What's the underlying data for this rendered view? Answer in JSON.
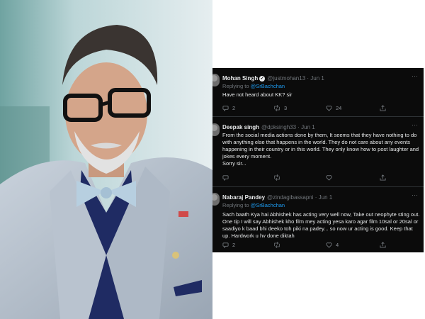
{
  "tweets": [
    {
      "name": "Mohan Singh",
      "handle": "@justmohan13 · Jun 1",
      "replying_prefix": "Replying to ",
      "replying_to": "@SrBachchan",
      "text": "Have not heard about KK? sir",
      "reply_count": "2",
      "retweet_count": "3",
      "like_count": "24"
    },
    {
      "name": "Deepak singh",
      "handle": "@dpksingh33 · Jun 1",
      "text": "From the social media actions done by them, It seems that they have nothing to do with anything else that happens in the world. They do not care about any events happening in their country or in this world.  They only know how to post laughter and jokes every moment.",
      "text2": "Sorry sir...",
      "reply_count": "",
      "retweet_count": "",
      "like_count": ""
    },
    {
      "name": "Nabaraj Pandey",
      "handle": "@zindagibassapni · Jun 1",
      "replying_prefix": "Replying to ",
      "replying_to": "@SrBachchan",
      "text": "Sach baath Kya hai Abhishek has acting very well now, Take out neophyte sting out. One tip I will say Abhishek kho film mey acting yesa karo agar film 10sal or 20sal or saadiyo k baad bhi deeko toh piki na padey... so now ur acting is good. Keep that up. Hardwork u hv done diktah",
      "reply_count": "2",
      "retweet_count": "",
      "like_count": "4"
    }
  ],
  "icons": {
    "more": "more-icon",
    "reply": "reply-icon",
    "retweet": "retweet-icon",
    "like": "heart-icon",
    "share": "share-icon",
    "verified": "verified-icon"
  },
  "colors": {
    "tweet_bg": "#0b0b0b",
    "mention": "#1d9bf0",
    "muted": "#71767b"
  }
}
